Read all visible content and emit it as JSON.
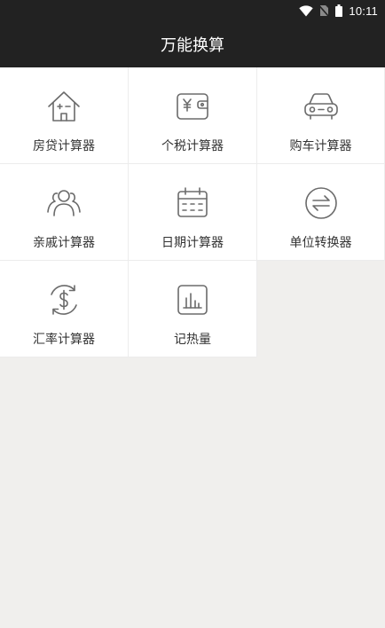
{
  "status_bar": {
    "time": "10:11"
  },
  "header": {
    "title": "万能换算"
  },
  "tools": [
    {
      "label": "房贷计算器",
      "icon": "house-icon"
    },
    {
      "label": "个税计算器",
      "icon": "wallet-yen-icon"
    },
    {
      "label": "购车计算器",
      "icon": "car-icon"
    },
    {
      "label": "亲戚计算器",
      "icon": "people-icon"
    },
    {
      "label": "日期计算器",
      "icon": "calendar-icon"
    },
    {
      "label": "单位转换器",
      "icon": "swap-arrows-icon"
    },
    {
      "label": "汇率计算器",
      "icon": "dollar-exchange-icon"
    },
    {
      "label": "记热量",
      "icon": "bar-chart-icon"
    }
  ],
  "colors": {
    "header_bg": "#222222",
    "icon_stroke": "#6b6b6b",
    "page_bg": "#f0efed"
  }
}
